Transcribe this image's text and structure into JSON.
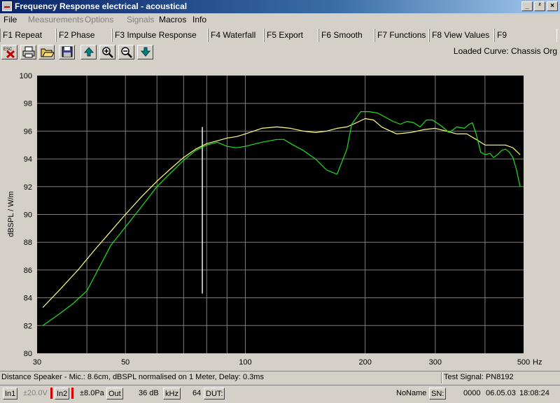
{
  "window": {
    "title": "Frequency Response electrical - acoustical",
    "controls": [
      "_",
      "²",
      "×"
    ]
  },
  "menu": [
    "File",
    "Measurements",
    "Options",
    "Signals",
    "Macros",
    "Info"
  ],
  "fkeys": [
    "F1 Repeat",
    "F2 Phase",
    "F3 Impulse Response",
    "F4 Waterfall",
    "F5 Export",
    "F6 Smooth",
    "F7 Functions",
    "F8 View Values",
    "F9"
  ],
  "toolbar": {
    "icons": [
      "esc-close-icon",
      "print-icon",
      "open-folder-icon",
      "save-icon",
      "arrow-up-icon",
      "zoom-in-icon",
      "zoom-out-icon",
      "arrow-down-icon"
    ],
    "loaded_curve": "Loaded Curve: Chassis Org"
  },
  "chart_data": {
    "type": "line",
    "ylabel": "dBSPL / W/m",
    "xunit": "Hz",
    "xscale": "log",
    "xlim": [
      30,
      500
    ],
    "ylim": [
      80,
      100
    ],
    "x_ticks": [
      30,
      50,
      100,
      200,
      300,
      500
    ],
    "x_tick_labels": [
      "30",
      "50",
      "100",
      "200",
      "300",
      "500"
    ],
    "x_minor": [
      40,
      60,
      70,
      80,
      90,
      400
    ],
    "y_ticks": [
      80,
      82,
      84,
      86,
      88,
      90,
      92,
      94,
      96,
      98,
      100
    ],
    "grid": true,
    "background": "#000000",
    "marker_line": {
      "x": 78,
      "y_range": [
        84.3,
        96.3
      ],
      "color": "#f0f0f0"
    },
    "series": [
      {
        "color": "#ffff80",
        "points": [
          [
            31,
            83.3
          ],
          [
            34,
            84.5
          ],
          [
            38,
            86.0
          ],
          [
            42,
            87.5
          ],
          [
            46,
            88.8
          ],
          [
            50,
            90.0
          ],
          [
            55,
            91.3
          ],
          [
            60,
            92.4
          ],
          [
            65,
            93.3
          ],
          [
            70,
            94.1
          ],
          [
            75,
            94.7
          ],
          [
            80,
            95.1
          ],
          [
            85,
            95.3
          ],
          [
            90,
            95.5
          ],
          [
            95,
            95.6
          ],
          [
            100,
            95.8
          ],
          [
            110,
            96.2
          ],
          [
            120,
            96.3
          ],
          [
            130,
            96.2
          ],
          [
            140,
            96.0
          ],
          [
            150,
            95.9
          ],
          [
            160,
            96.0
          ],
          [
            170,
            96.2
          ],
          [
            180,
            96.3
          ],
          [
            190,
            96.6
          ],
          [
            200,
            96.9
          ],
          [
            210,
            96.8
          ],
          [
            220,
            96.3
          ],
          [
            240,
            95.8
          ],
          [
            260,
            95.9
          ],
          [
            280,
            96.1
          ],
          [
            300,
            96.2
          ],
          [
            320,
            96.0
          ],
          [
            340,
            95.8
          ],
          [
            360,
            95.8
          ],
          [
            380,
            95.4
          ],
          [
            400,
            95.0
          ],
          [
            420,
            95.0
          ],
          [
            450,
            95.0
          ],
          [
            470,
            94.8
          ],
          [
            490,
            94.3
          ]
        ]
      },
      {
        "color": "#20e020",
        "points": [
          [
            31,
            82.0
          ],
          [
            34,
            82.8
          ],
          [
            37,
            83.6
          ],
          [
            40,
            84.5
          ],
          [
            43,
            86.2
          ],
          [
            46,
            87.8
          ],
          [
            50,
            89.1
          ],
          [
            55,
            90.6
          ],
          [
            60,
            92.0
          ],
          [
            65,
            93.0
          ],
          [
            70,
            93.9
          ],
          [
            75,
            94.6
          ],
          [
            80,
            95.0
          ],
          [
            85,
            95.2
          ],
          [
            90,
            94.9
          ],
          [
            95,
            94.8
          ],
          [
            100,
            94.9
          ],
          [
            110,
            95.2
          ],
          [
            120,
            95.4
          ],
          [
            125,
            95.4
          ],
          [
            130,
            95.1
          ],
          [
            140,
            94.6
          ],
          [
            150,
            94.0
          ],
          [
            160,
            93.2
          ],
          [
            170,
            92.9
          ],
          [
            180,
            94.7
          ],
          [
            185,
            96.5
          ],
          [
            195,
            97.4
          ],
          [
            205,
            97.4
          ],
          [
            215,
            97.3
          ],
          [
            225,
            97.0
          ],
          [
            235,
            96.7
          ],
          [
            245,
            96.5
          ],
          [
            255,
            96.7
          ],
          [
            265,
            96.6
          ],
          [
            275,
            96.3
          ],
          [
            285,
            96.8
          ],
          [
            295,
            96.8
          ],
          [
            310,
            96.4
          ],
          [
            325,
            95.9
          ],
          [
            340,
            96.3
          ],
          [
            355,
            96.2
          ],
          [
            365,
            96.5
          ],
          [
            372,
            96.6
          ],
          [
            380,
            95.8
          ],
          [
            390,
            94.5
          ],
          [
            400,
            94.3
          ],
          [
            412,
            94.4
          ],
          [
            420,
            94.1
          ],
          [
            430,
            94.3
          ],
          [
            440,
            94.6
          ],
          [
            450,
            94.7
          ],
          [
            460,
            94.5
          ],
          [
            470,
            94.1
          ],
          [
            480,
            93.2
          ],
          [
            490,
            92.0
          ]
        ]
      }
    ]
  },
  "status": {
    "distance": "Distance Speaker - Mic.: 8.6cm, dBSPL normalised on 1 Meter, Delay: 0.3ms",
    "test_signal": "Test Signal: PN8192",
    "in1": "In1",
    "in1_level": "±20.0V",
    "in2": "In2",
    "in2_level": "±8.0Pa",
    "out": "Out",
    "gain": "36 dB",
    "khz": "kHz",
    "avg": "64",
    "dut": "DUT:",
    "noname": "NoName",
    "sn": "SN:",
    "counter": "0000",
    "date": "06.05.03",
    "time": "18:08:24"
  }
}
